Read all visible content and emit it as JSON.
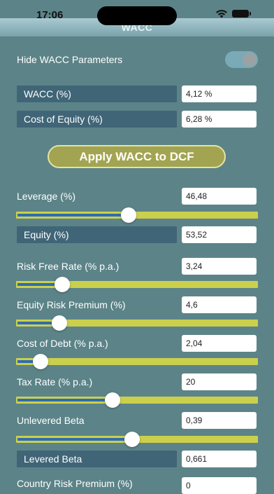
{
  "status_bar": {
    "time": "17:06"
  },
  "nav": {
    "title": "WACC"
  },
  "hide_params": {
    "label": "Hide WACC Parameters",
    "enabled": true
  },
  "outputs": {
    "wacc_label": "WACC (%)",
    "wacc_value": "4,12 %",
    "cost_equity_label": "Cost of Equity (%)",
    "cost_equity_value": "6,28 %"
  },
  "apply_button": {
    "label": "Apply WACC to DCF"
  },
  "leverage": {
    "label": "Leverage (%)",
    "value": "46,48",
    "slider_level": 0.465
  },
  "equity": {
    "label": "Equity (%)",
    "value": "53,52"
  },
  "risk_free": {
    "label": "Risk Free Rate (% p.a.)",
    "value": "3,24",
    "slider_level": 0.19
  },
  "equity_risk_premium": {
    "label": "Equity Risk Premium (%)",
    "value": "4,6",
    "slider_level": 0.18
  },
  "cost_of_debt": {
    "label": "Cost of Debt (% p.a.)",
    "value": "2,04",
    "slider_level": 0.1
  },
  "tax_rate": {
    "label": "Tax Rate (% p.a.)",
    "value": "20",
    "slider_level": 0.4
  },
  "unlevered_beta": {
    "label": "Unlevered Beta",
    "value": "0,39",
    "slider_level": 0.48
  },
  "levered_beta": {
    "label": "Levered Beta",
    "value": "0,661"
  },
  "country_risk": {
    "label": "Country Risk Premium (%)",
    "value": "0"
  },
  "colors": {
    "background": "#5c8488",
    "label_box": "#3f6577",
    "slider_track": "#cbd04c",
    "slider_fill": "#2f6db0",
    "button": "#a3a451"
  }
}
